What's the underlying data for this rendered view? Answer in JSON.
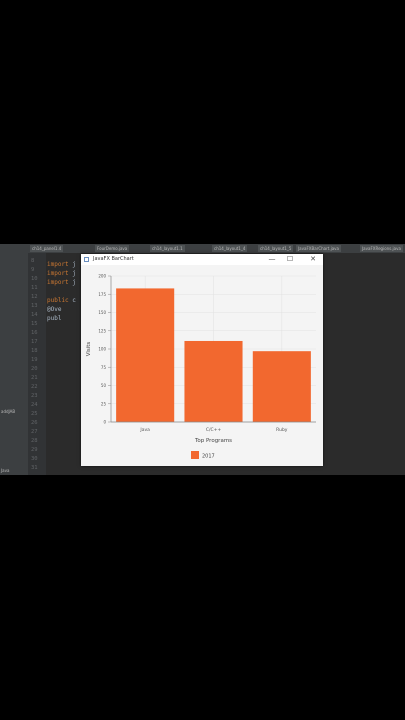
{
  "ide": {
    "tabs": [
      "ch14_panel1.4",
      "FourDemo.java",
      "ch14_layout1.1",
      "ch14_layout1_4",
      "ch14_layout1_5",
      "JavaFXBarChart.java",
      "JavaFXRegions.java"
    ],
    "line_numbers": [
      "8",
      "9",
      "10",
      "11",
      "12",
      "13",
      "14",
      "15",
      "16",
      "17",
      "18",
      "19",
      "20",
      "21",
      "22",
      "23",
      "24",
      "25",
      "26",
      "27",
      "28",
      "29",
      "30",
      "31"
    ],
    "code_lines": [
      {
        "kw": "import",
        "rest": " j"
      },
      {
        "kw": "import",
        "rest": " j"
      },
      {
        "kw": "import",
        "rest": " j"
      },
      {
        "kw": "",
        "rest": ""
      },
      {
        "kw": "public",
        "rest": " c"
      },
      {
        "kw": "",
        "rest": "  @Ove"
      },
      {
        "kw": "",
        "rest": "  publ"
      }
    ],
    "left_panel_labels": [
      "addJAB",
      "Java"
    ]
  },
  "window": {
    "title": "JavaFX BarChart",
    "minimize": "—",
    "maximize": "☐",
    "close": "✕"
  },
  "colors": {
    "bar": "#f2682f",
    "ide_bg": "#2b2b2b",
    "plot_bg": "#f4f4f4"
  },
  "chart_data": {
    "type": "bar",
    "title": "",
    "xlabel": "Top Programs",
    "ylabel": "Visits",
    "categories": [
      "Java",
      "C/C++",
      "Ruby"
    ],
    "series": [
      {
        "name": "2017",
        "values": [
          183,
          111,
          97
        ]
      }
    ],
    "ylim": [
      0,
      200
    ],
    "yticks": [
      0,
      25,
      50,
      75,
      100,
      125,
      150,
      175,
      200
    ],
    "grid": true,
    "legend": "bottom"
  }
}
